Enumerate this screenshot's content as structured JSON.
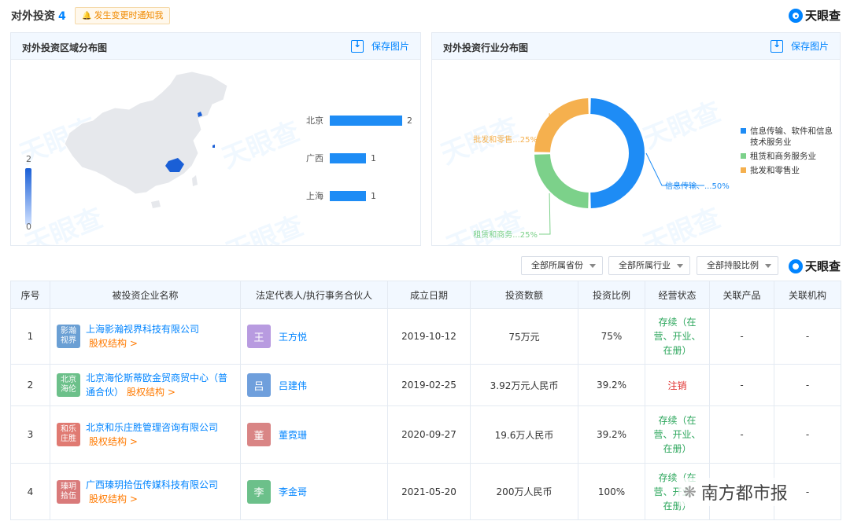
{
  "header": {
    "title": "对外投资",
    "count": "4",
    "notify_label": "发生变更时通知我",
    "brand": "天眼查"
  },
  "watermark_text": "天眼查",
  "region_panel": {
    "title": "对外投资区域分布图",
    "save_label": "保存图片",
    "legend_max": "2",
    "legend_min": "0"
  },
  "industry_panel": {
    "title": "对外投资行业分布图",
    "save_label": "保存图片"
  },
  "chart_data": [
    {
      "type": "bar",
      "orientation": "horizontal",
      "categories": [
        "北京",
        "广西",
        "上海"
      ],
      "values": [
        2,
        1,
        1
      ],
      "color": "#1e8cf5",
      "xlim": [
        0,
        2
      ]
    },
    {
      "type": "pie",
      "style": "donut",
      "slices": [
        {
          "label": "信息传输、软件和信息技术服务业",
          "short_label": "信息传输、...50%",
          "value": 50,
          "color": "#1e8cf5"
        },
        {
          "label": "租赁和商务服务业",
          "short_label": "租赁和商务...25%",
          "value": 25,
          "color": "#7cd18a"
        },
        {
          "label": "批发和零售业",
          "short_label": "批发和零售...25%",
          "value": 25,
          "color": "#f5b04e"
        }
      ],
      "legend": [
        "信息传输、软件和信息技术服务业",
        "租赁和商务服务业",
        "批发和零售业"
      ],
      "legend_placement": "right"
    }
  ],
  "filters": [
    {
      "label": "全部所属省份"
    },
    {
      "label": "全部所属行业"
    },
    {
      "label": "全部持股比例"
    }
  ],
  "filter_brand": "天眼查",
  "table": {
    "headers": [
      "序号",
      "被投资企业名称",
      "法定代表人/执行事务合伙人",
      "成立日期",
      "投资数额",
      "投资比例",
      "经营状态",
      "关联产品",
      "关联机构"
    ],
    "equity_label": "股权结构 >",
    "rows": [
      {
        "index": "1",
        "logo_text": "影瀚视界",
        "logo_color": "#6a9fd4",
        "company": "上海影瀚视界科技有限公司",
        "avatar": "王",
        "avatar_color": "#b89be0",
        "person": "王方悦",
        "date": "2019-10-12",
        "amount": "75万元",
        "ratio": "75%",
        "status": "存续（在营、开业、在册）",
        "status_type": "ok",
        "product": "-",
        "org": "-"
      },
      {
        "index": "2",
        "logo_text": "北京海伦",
        "logo_color": "#6cc08a",
        "company": "北京海伦斯蒂欧金贸商贸中心（普通合伙）",
        "avatar": "吕",
        "avatar_color": "#6f9fdc",
        "person": "吕建伟",
        "date": "2019-02-25",
        "amount": "3.92万元人民币",
        "ratio": "39.2%",
        "status": "注销",
        "status_type": "bad",
        "product": "-",
        "org": "-"
      },
      {
        "index": "3",
        "logo_text": "和乐庄胜",
        "logo_color": "#e07a72",
        "company": "北京和乐庄胜管理咨询有限公司",
        "avatar": "董",
        "avatar_color": "#d98585",
        "person": "董霓珊",
        "date": "2020-09-27",
        "amount": "19.6万人民币",
        "ratio": "39.2%",
        "status": "存续（在营、开业、在册）",
        "status_type": "ok",
        "product": "-",
        "org": "-"
      },
      {
        "index": "4",
        "logo_text": "瑧玥拾伍",
        "logo_color": "#d97a7a",
        "company": "广西瑧玥拾伍传媒科技有限公司",
        "avatar": "李",
        "avatar_color": "#6cc08a",
        "person": "李金哥",
        "date": "2021-05-20",
        "amount": "200万人民币",
        "ratio": "100%",
        "status": "存续（在营、开业、在册）",
        "status_type": "ok",
        "product": "-",
        "org": "-"
      }
    ]
  },
  "news_watermark": "南方都市报"
}
